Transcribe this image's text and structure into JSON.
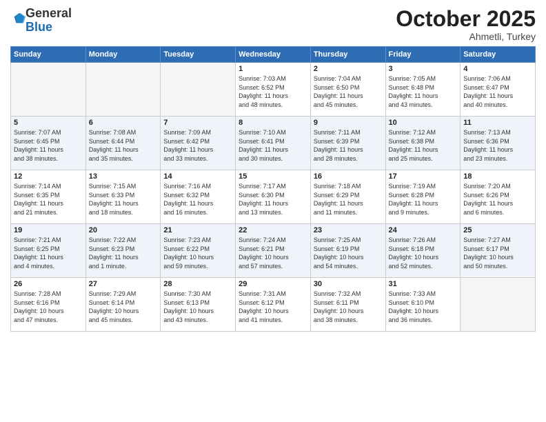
{
  "header": {
    "logo_general": "General",
    "logo_blue": "Blue",
    "month_title": "October 2025",
    "subtitle": "Ahmetli, Turkey"
  },
  "weekdays": [
    "Sunday",
    "Monday",
    "Tuesday",
    "Wednesday",
    "Thursday",
    "Friday",
    "Saturday"
  ],
  "weeks": [
    [
      {
        "day": "",
        "info": ""
      },
      {
        "day": "",
        "info": ""
      },
      {
        "day": "",
        "info": ""
      },
      {
        "day": "1",
        "info": "Sunrise: 7:03 AM\nSunset: 6:52 PM\nDaylight: 11 hours\nand 48 minutes."
      },
      {
        "day": "2",
        "info": "Sunrise: 7:04 AM\nSunset: 6:50 PM\nDaylight: 11 hours\nand 45 minutes."
      },
      {
        "day": "3",
        "info": "Sunrise: 7:05 AM\nSunset: 6:48 PM\nDaylight: 11 hours\nand 43 minutes."
      },
      {
        "day": "4",
        "info": "Sunrise: 7:06 AM\nSunset: 6:47 PM\nDaylight: 11 hours\nand 40 minutes."
      }
    ],
    [
      {
        "day": "5",
        "info": "Sunrise: 7:07 AM\nSunset: 6:45 PM\nDaylight: 11 hours\nand 38 minutes."
      },
      {
        "day": "6",
        "info": "Sunrise: 7:08 AM\nSunset: 6:44 PM\nDaylight: 11 hours\nand 35 minutes."
      },
      {
        "day": "7",
        "info": "Sunrise: 7:09 AM\nSunset: 6:42 PM\nDaylight: 11 hours\nand 33 minutes."
      },
      {
        "day": "8",
        "info": "Sunrise: 7:10 AM\nSunset: 6:41 PM\nDaylight: 11 hours\nand 30 minutes."
      },
      {
        "day": "9",
        "info": "Sunrise: 7:11 AM\nSunset: 6:39 PM\nDaylight: 11 hours\nand 28 minutes."
      },
      {
        "day": "10",
        "info": "Sunrise: 7:12 AM\nSunset: 6:38 PM\nDaylight: 11 hours\nand 25 minutes."
      },
      {
        "day": "11",
        "info": "Sunrise: 7:13 AM\nSunset: 6:36 PM\nDaylight: 11 hours\nand 23 minutes."
      }
    ],
    [
      {
        "day": "12",
        "info": "Sunrise: 7:14 AM\nSunset: 6:35 PM\nDaylight: 11 hours\nand 21 minutes."
      },
      {
        "day": "13",
        "info": "Sunrise: 7:15 AM\nSunset: 6:33 PM\nDaylight: 11 hours\nand 18 minutes."
      },
      {
        "day": "14",
        "info": "Sunrise: 7:16 AM\nSunset: 6:32 PM\nDaylight: 11 hours\nand 16 minutes."
      },
      {
        "day": "15",
        "info": "Sunrise: 7:17 AM\nSunset: 6:30 PM\nDaylight: 11 hours\nand 13 minutes."
      },
      {
        "day": "16",
        "info": "Sunrise: 7:18 AM\nSunset: 6:29 PM\nDaylight: 11 hours\nand 11 minutes."
      },
      {
        "day": "17",
        "info": "Sunrise: 7:19 AM\nSunset: 6:28 PM\nDaylight: 11 hours\nand 9 minutes."
      },
      {
        "day": "18",
        "info": "Sunrise: 7:20 AM\nSunset: 6:26 PM\nDaylight: 11 hours\nand 6 minutes."
      }
    ],
    [
      {
        "day": "19",
        "info": "Sunrise: 7:21 AM\nSunset: 6:25 PM\nDaylight: 11 hours\nand 4 minutes."
      },
      {
        "day": "20",
        "info": "Sunrise: 7:22 AM\nSunset: 6:23 PM\nDaylight: 11 hours\nand 1 minute."
      },
      {
        "day": "21",
        "info": "Sunrise: 7:23 AM\nSunset: 6:22 PM\nDaylight: 10 hours\nand 59 minutes."
      },
      {
        "day": "22",
        "info": "Sunrise: 7:24 AM\nSunset: 6:21 PM\nDaylight: 10 hours\nand 57 minutes."
      },
      {
        "day": "23",
        "info": "Sunrise: 7:25 AM\nSunset: 6:19 PM\nDaylight: 10 hours\nand 54 minutes."
      },
      {
        "day": "24",
        "info": "Sunrise: 7:26 AM\nSunset: 6:18 PM\nDaylight: 10 hours\nand 52 minutes."
      },
      {
        "day": "25",
        "info": "Sunrise: 7:27 AM\nSunset: 6:17 PM\nDaylight: 10 hours\nand 50 minutes."
      }
    ],
    [
      {
        "day": "26",
        "info": "Sunrise: 7:28 AM\nSunset: 6:16 PM\nDaylight: 10 hours\nand 47 minutes."
      },
      {
        "day": "27",
        "info": "Sunrise: 7:29 AM\nSunset: 6:14 PM\nDaylight: 10 hours\nand 45 minutes."
      },
      {
        "day": "28",
        "info": "Sunrise: 7:30 AM\nSunset: 6:13 PM\nDaylight: 10 hours\nand 43 minutes."
      },
      {
        "day": "29",
        "info": "Sunrise: 7:31 AM\nSunset: 6:12 PM\nDaylight: 10 hours\nand 41 minutes."
      },
      {
        "day": "30",
        "info": "Sunrise: 7:32 AM\nSunset: 6:11 PM\nDaylight: 10 hours\nand 38 minutes."
      },
      {
        "day": "31",
        "info": "Sunrise: 7:33 AM\nSunset: 6:10 PM\nDaylight: 10 hours\nand 36 minutes."
      },
      {
        "day": "",
        "info": ""
      }
    ]
  ]
}
